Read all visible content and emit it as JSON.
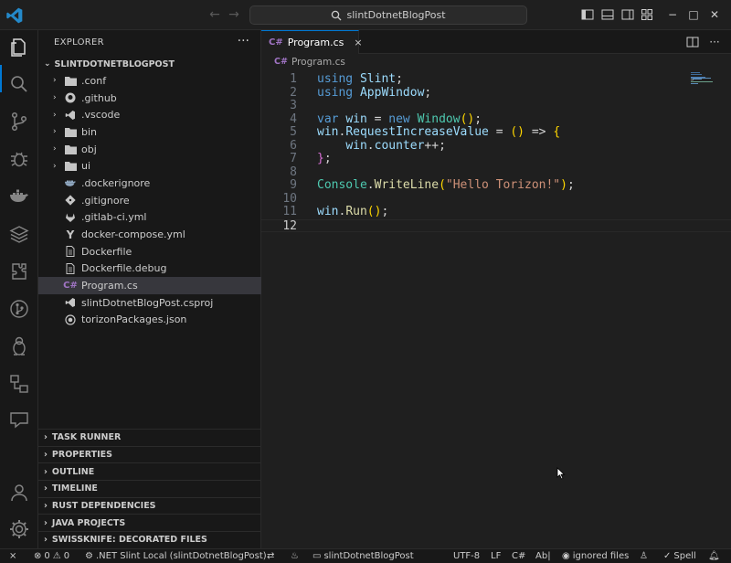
{
  "window": {
    "search_text": "slintDotnetBlogPost"
  },
  "explorer": {
    "title": "EXPLORER",
    "more": "···",
    "root_label": "SLINTDOTNETBLOGPOST",
    "items": [
      {
        "label": ".conf",
        "icon": "folder-icon"
      },
      {
        "label": ".github",
        "icon": "github-icon"
      },
      {
        "label": ".vscode",
        "icon": "vscode-folder-icon"
      },
      {
        "label": "bin",
        "icon": "folder-icon"
      },
      {
        "label": "obj",
        "icon": "folder-icon"
      },
      {
        "label": "ui",
        "icon": "folder-icon"
      },
      {
        "label": ".dockerignore",
        "icon": "docker-icon"
      },
      {
        "label": ".gitignore",
        "icon": "git-icon"
      },
      {
        "label": ".gitlab-ci.yml",
        "icon": "gitlab-icon"
      },
      {
        "label": "docker-compose.yml",
        "icon": "yaml-icon"
      },
      {
        "label": "Dockerfile",
        "icon": "file-icon"
      },
      {
        "label": "Dockerfile.debug",
        "icon": "file-icon"
      },
      {
        "label": "Program.cs",
        "icon": "csharp-icon",
        "icon_text": "C#"
      },
      {
        "label": "slintDotnetBlogPost.csproj",
        "icon": "csproj-icon"
      },
      {
        "label": "torizonPackages.json",
        "icon": "json-icon"
      }
    ],
    "sections": [
      "TASK RUNNER",
      "PROPERTIES",
      "OUTLINE",
      "TIMELINE",
      "RUST DEPENDENCIES",
      "JAVA PROJECTS",
      "SWISSKNIFE: DECORATED FILES"
    ]
  },
  "editor": {
    "tab": {
      "icon_text": "C#",
      "label": "Program.cs",
      "close": "×"
    },
    "breadcrumb": {
      "icon_text": "C#",
      "file": "Program.cs"
    },
    "lines": [
      {
        "n": "1",
        "text": "using Slint;"
      },
      {
        "n": "2",
        "text": "using AppWindow;"
      },
      {
        "n": "3",
        "text": ""
      },
      {
        "n": "4",
        "text": "var win = new Window();"
      },
      {
        "n": "5",
        "text": "win.RequestIncreaseValue = () => {"
      },
      {
        "n": "6",
        "text": "    win.counter++;"
      },
      {
        "n": "7",
        "text": "};"
      },
      {
        "n": "8",
        "text": ""
      },
      {
        "n": "9",
        "text": "Console.WriteLine(\"Hello Torizon!\");"
      },
      {
        "n": "10",
        "text": ""
      },
      {
        "n": "11",
        "text": "win.Run();"
      },
      {
        "n": "12",
        "text": ""
      }
    ]
  },
  "statusbar": {
    "remote": "⨯",
    "errors": "0",
    "warnings": "0",
    "debug_config": ".NET Slint Local (slintDotnetBlogPost)",
    "folder": "slintDotnetBlogPost",
    "encoding": "UTF-8",
    "eol": "LF",
    "language": "C#",
    "spell_marker": "Ab|",
    "ignored": "ignored files",
    "spell": "Spell"
  },
  "colors": {
    "accent": "#0078d4",
    "background": "#1f1f1f",
    "sidebar": "#181818"
  }
}
